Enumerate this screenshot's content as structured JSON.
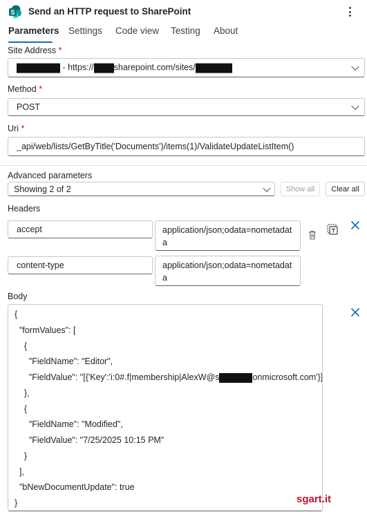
{
  "header": {
    "title": "Send an HTTP request to SharePoint",
    "app_icon": "sharepoint-icon",
    "more_icon": "more-vertical-icon"
  },
  "tabs": [
    {
      "label": "Parameters",
      "active": true
    },
    {
      "label": "Settings",
      "active": false
    },
    {
      "label": "Code view",
      "active": false
    },
    {
      "label": "Testing",
      "active": false
    },
    {
      "label": "About",
      "active": false
    }
  ],
  "site_address": {
    "label": "Site Address",
    "required_mark": "*",
    "value_prefix": "- https://",
    "value_middle": "sharepoint.com/sites/"
  },
  "method": {
    "label": "Method",
    "required_mark": "*",
    "value": "POST"
  },
  "uri": {
    "label": "Uri",
    "required_mark": "*",
    "value": "_api/web/lists/GetByTitle('Documents')/items(1)/ValidateUpdateListItem()"
  },
  "advanced": {
    "label": "Advanced parameters",
    "selected": "Showing 2 of 2",
    "show_all_label": "Show all",
    "clear_all_label": "Clear all"
  },
  "headers_section": {
    "label": "Headers",
    "rows": [
      {
        "key": "accept",
        "value": "application/json;odata=nometadata"
      },
      {
        "key": "content-type",
        "value": "application/json;odata=nometadata"
      }
    ]
  },
  "body_section": {
    "label": "Body",
    "lines": [
      "{",
      "  \"formValues\": [",
      "    {",
      "      \"FieldName\": \"Editor\",",
      "      \"FieldValue\": \"[{'Key':'i:0#.f|membership|AlexW@s",
      "    },",
      "    {",
      "      \"FieldName\": \"Modified\",",
      "      \"FieldValue\": \"7/25/2025 10:15 PM\"",
      "    }",
      "  ],",
      "  \"bNewDocumentUpdate\": true",
      "}"
    ],
    "editor_line_suffix": "onmicrosoft.com'}]\""
  },
  "watermark": "sgart.it",
  "colors": {
    "accent": "#0f6cbd",
    "required": "#c50f1f",
    "watermark": "#c8102e",
    "sharepoint": "#038387"
  }
}
